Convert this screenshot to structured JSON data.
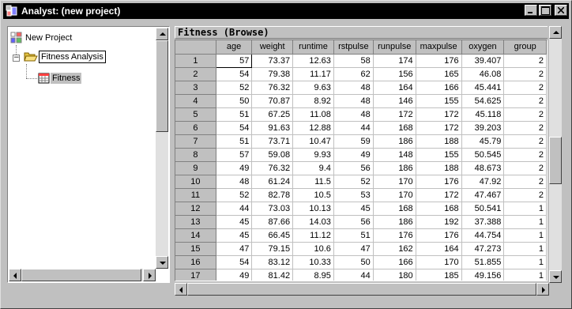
{
  "window": {
    "title": "Analyst: (new project)"
  },
  "tree": {
    "items": [
      {
        "label": "New Project"
      },
      {
        "label": "Fitness Analysis",
        "expand": "−"
      },
      {
        "label": "Fitness"
      }
    ]
  },
  "browse": {
    "title": "Fitness (Browse)",
    "columns": [
      "age",
      "weight",
      "runtime",
      "rstpulse",
      "runpulse",
      "maxpulse",
      "oxygen",
      "group"
    ],
    "rows": [
      [
        "1",
        "57",
        "73.37",
        "12.63",
        "58",
        "174",
        "176",
        "39.407",
        "2"
      ],
      [
        "2",
        "54",
        "79.38",
        "11.17",
        "62",
        "156",
        "165",
        "46.08",
        "2"
      ],
      [
        "3",
        "52",
        "76.32",
        "9.63",
        "48",
        "164",
        "166",
        "45.441",
        "2"
      ],
      [
        "4",
        "50",
        "70.87",
        "8.92",
        "48",
        "146",
        "155",
        "54.625",
        "2"
      ],
      [
        "5",
        "51",
        "67.25",
        "11.08",
        "48",
        "172",
        "172",
        "45.118",
        "2"
      ],
      [
        "6",
        "54",
        "91.63",
        "12.88",
        "44",
        "168",
        "172",
        "39.203",
        "2"
      ],
      [
        "7",
        "51",
        "73.71",
        "10.47",
        "59",
        "186",
        "188",
        "45.79",
        "2"
      ],
      [
        "8",
        "57",
        "59.08",
        "9.93",
        "49",
        "148",
        "155",
        "50.545",
        "2"
      ],
      [
        "9",
        "49",
        "76.32",
        "9.4",
        "56",
        "186",
        "188",
        "48.673",
        "2"
      ],
      [
        "10",
        "48",
        "61.24",
        "11.5",
        "52",
        "170",
        "176",
        "47.92",
        "2"
      ],
      [
        "11",
        "52",
        "82.78",
        "10.5",
        "53",
        "170",
        "172",
        "47.467",
        "2"
      ],
      [
        "12",
        "44",
        "73.03",
        "10.13",
        "45",
        "168",
        "168",
        "50.541",
        "1"
      ],
      [
        "13",
        "45",
        "87.66",
        "14.03",
        "56",
        "186",
        "192",
        "37.388",
        "1"
      ],
      [
        "14",
        "45",
        "66.45",
        "11.12",
        "51",
        "176",
        "176",
        "44.754",
        "1"
      ],
      [
        "15",
        "47",
        "79.15",
        "10.6",
        "47",
        "162",
        "164",
        "47.273",
        "1"
      ],
      [
        "16",
        "54",
        "83.12",
        "10.33",
        "50",
        "166",
        "170",
        "51.855",
        "1"
      ],
      [
        "17",
        "49",
        "81.42",
        "8.95",
        "44",
        "180",
        "185",
        "49.156",
        "1"
      ]
    ]
  }
}
